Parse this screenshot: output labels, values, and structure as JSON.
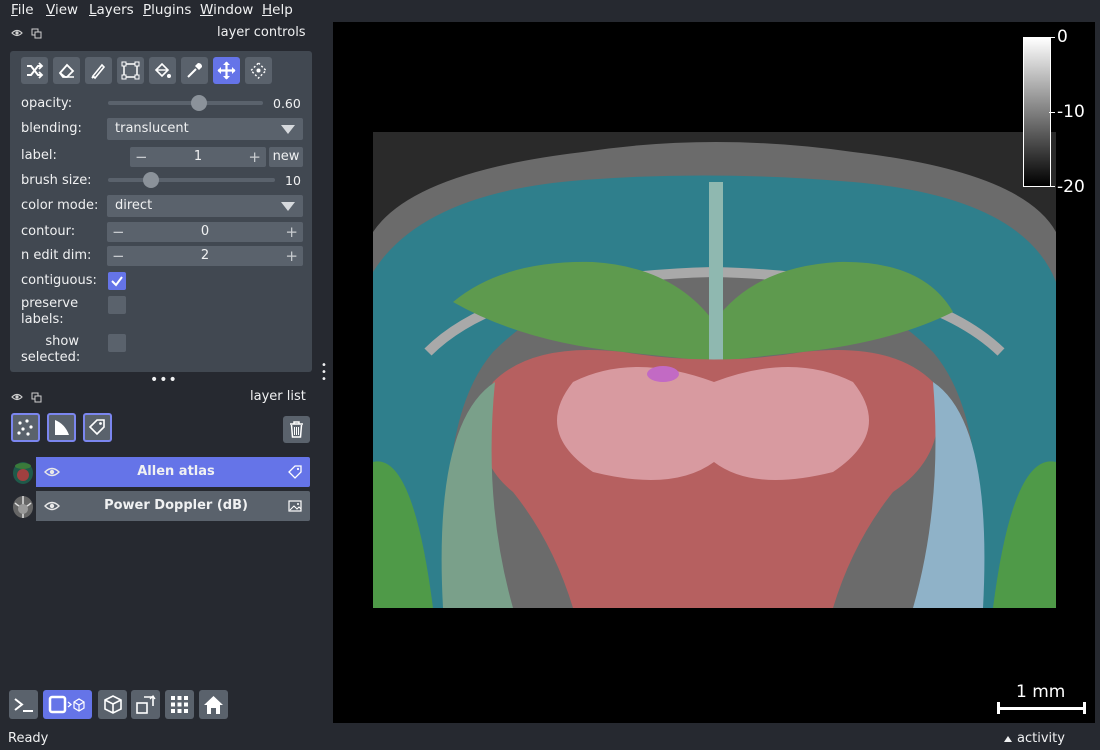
{
  "menu": [
    "File",
    "View",
    "Layers",
    "Plugins",
    "Window",
    "Help"
  ],
  "menu_underline": [
    "F",
    "V",
    "L",
    "P",
    "W",
    "H"
  ],
  "menu_rest": [
    "ile",
    "iew",
    "ayers",
    "lugins",
    "indow",
    "elp"
  ],
  "layer_controls": {
    "title": "layer controls",
    "tools": [
      "shuffle-icon",
      "eraser-icon",
      "paint-brush-icon",
      "polygon-icon",
      "fill-bucket-icon",
      "color-picker-icon",
      "pan-zoom-icon",
      "transform-icon"
    ],
    "active_tool": "pan-zoom-icon",
    "opacity": {
      "label": "opacity:",
      "value": "0.60",
      "fraction": 0.6
    },
    "blending": {
      "label": "blending:",
      "value": "translucent"
    },
    "label": {
      "label": "label:",
      "value": "1",
      "new_button": "new"
    },
    "brush_size": {
      "label": "brush size:",
      "value": "10",
      "fraction": 0.25
    },
    "color_mode": {
      "label": "color mode:",
      "value": "direct"
    },
    "contour": {
      "label": "contour:",
      "value": "0"
    },
    "n_edit_dim": {
      "label": "n edit dim:",
      "value": "2"
    },
    "contiguous": {
      "label": "contiguous:",
      "checked": true
    },
    "preserve_labels": {
      "label1": "preserve",
      "label2": "labels:",
      "checked": false
    },
    "show_selected": {
      "label1": "show",
      "label2": "selected:",
      "checked": false
    }
  },
  "layer_list": {
    "title": "layer list",
    "layers": [
      {
        "name": "Allen atlas",
        "selected": true,
        "type_icon": "label-tag-icon"
      },
      {
        "name": "Power Doppler (dB)",
        "selected": false,
        "type_icon": "image-icon"
      }
    ]
  },
  "colorbar": {
    "top": "0",
    "mid": "-10",
    "bottom": "-20"
  },
  "scale_bar": "1 mm",
  "status": "Ready",
  "activity": "activity",
  "colors": {
    "accent": "#6574e8",
    "panel": "#414851",
    "background": "#262930",
    "button": "#5a626c"
  }
}
